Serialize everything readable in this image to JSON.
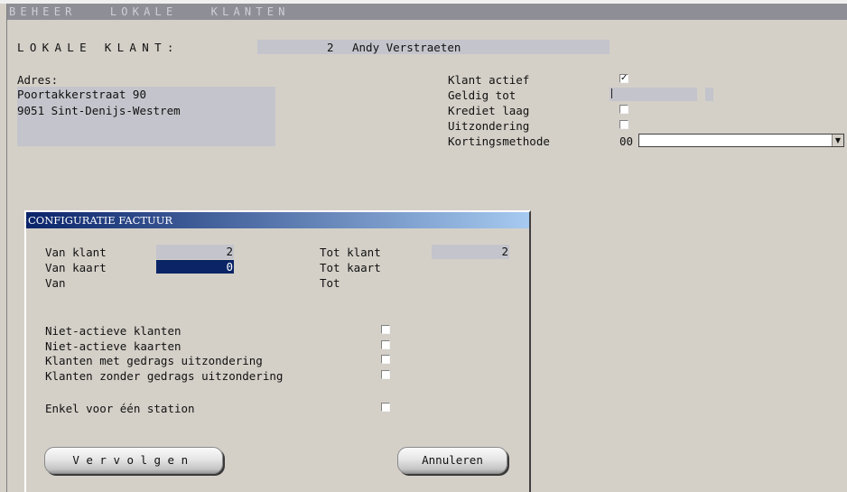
{
  "window": {
    "title": "BEHEER   LOKALE   KLANTEN"
  },
  "customer": {
    "label": "LOKALE  KLANT:",
    "number": "2",
    "name": "Andy Verstraeten",
    "address_label": "Adres:",
    "address_line1": "Poortakkerstraat 90",
    "address_line2": "9051 Sint-Denijs-Westrem"
  },
  "flags": {
    "klant_actief": {
      "label": "Klant actief",
      "checked": true
    },
    "geldig_tot": {
      "label": "Geldig tot",
      "value": ""
    },
    "krediet_laag": {
      "label": "Krediet laag",
      "checked": false
    },
    "uitzondering": {
      "label": "Uitzondering",
      "checked": false
    },
    "kortingsmethode": {
      "label": "Kortingsmethode",
      "code": "00",
      "selected": ""
    }
  },
  "dialog": {
    "title": "CONFIGURATIE FACTUUR",
    "van_klant": {
      "label": "Van klant",
      "value": "2"
    },
    "tot_klant": {
      "label": "Tot klant",
      "value": "2"
    },
    "van_kaart": {
      "label": "Van kaart",
      "value": "0"
    },
    "tot_kaart": {
      "label": "Tot kaart"
    },
    "van": {
      "label": "Van"
    },
    "tot": {
      "label": "Tot"
    },
    "options": [
      {
        "label": "Niet-actieve klanten",
        "checked": false
      },
      {
        "label": "Niet-actieve kaarten",
        "checked": false
      },
      {
        "label": "Klanten met gedrags uitzondering",
        "checked": false
      },
      {
        "label": "Klanten zonder gedrags uitzondering",
        "checked": false
      }
    ],
    "single_station": {
      "label": "Enkel voor één station",
      "checked": false
    },
    "continue_label": "Vervolgen",
    "cancel_label": "Annuleren"
  },
  "colors": {
    "field_bg": "#c4c4cc",
    "selected_bg": "#0a2466",
    "title_gradient_start": "#0a246a",
    "title_gradient_end": "#a6caf0"
  }
}
